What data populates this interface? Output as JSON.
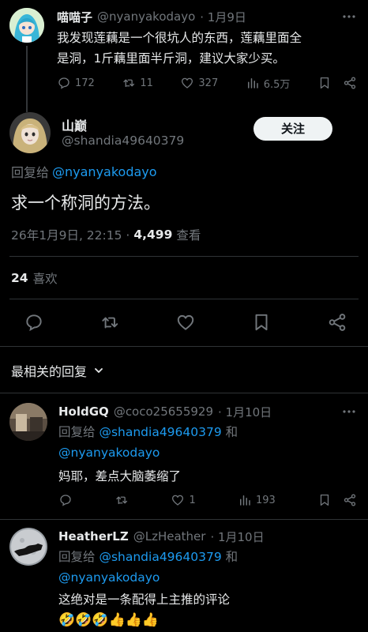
{
  "parent": {
    "name": "喵喵子",
    "handle": "@nyanyakodayo",
    "date": "· 1月9日",
    "text_line1": "我发现莲藕是一个很坑人的东西，莲藕里面全",
    "text_line2": "是洞，1斤藕里面半斤洞，建议大家少买。",
    "replies": "172",
    "reposts": "11",
    "likes": "327",
    "views": "6.5万"
  },
  "main": {
    "name": "山巅",
    "handle": "@shandia49640379",
    "follow_label": "关注",
    "reply_to_prefix": "回复给",
    "reply_to_handle": "@nyanyakodayo",
    "text": "求一个称洞的方法。",
    "timestamp": "26年1月9日, 22:15 ·",
    "views_count": "4,499",
    "views_label": "查看",
    "likes_count": "24",
    "likes_label": "喜欢"
  },
  "replies_header": "最相关的回复",
  "replies": [
    {
      "name": "HoldGQ",
      "handle": "@coco25655929",
      "date": "· 1月10日",
      "reply_prefix": "回复给",
      "reply_handle1": "@shandia49640379",
      "reply_and": "和",
      "reply_handle2": "@nyanyakodayo",
      "text": "妈耶，差点大脑萎缩了",
      "replies": "",
      "reposts": "",
      "likes": "1",
      "views": "193"
    },
    {
      "name": "HeatherLZ",
      "handle": "@LzHeather",
      "date": "· 1月10日",
      "reply_prefix": "回复给",
      "reply_handle1": "@shandia49640379",
      "reply_and": "和",
      "reply_handle2": "@nyanyakodayo",
      "text": "这绝对是一条配得上主推的评论",
      "emojis": "🤣🤣🤣👍👍👍"
    }
  ],
  "colors": {
    "background": "#000000",
    "text": "#e7e9ea",
    "muted": "#71767b",
    "link": "#1d9bf0",
    "divider": "#2f3336"
  }
}
